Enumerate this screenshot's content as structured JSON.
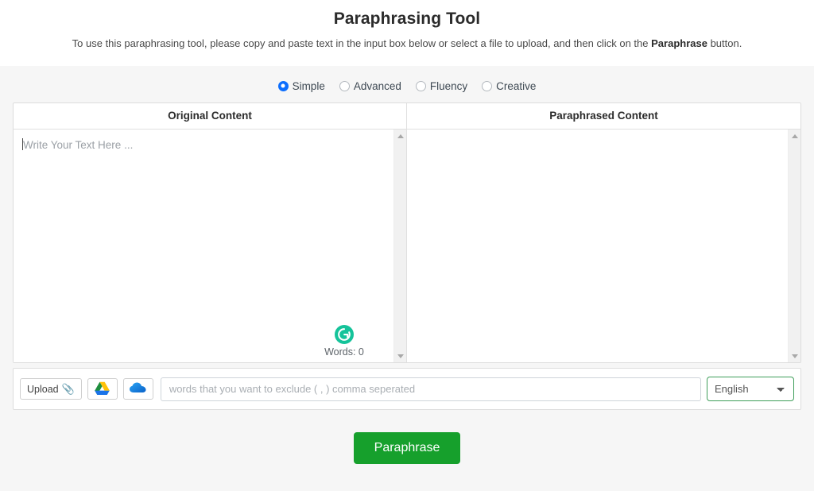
{
  "header": {
    "title": "Paraphrasing Tool",
    "subtitle_before": "To use this paraphrasing tool, please copy and paste text in the input box below or select a file to upload, and then click on the ",
    "subtitle_bold": "Paraphrase",
    "subtitle_after": " button."
  },
  "modes": {
    "options": [
      {
        "label": "Simple",
        "selected": true
      },
      {
        "label": "Advanced",
        "selected": false
      },
      {
        "label": "Fluency",
        "selected": false
      },
      {
        "label": "Creative",
        "selected": false
      }
    ]
  },
  "panels": {
    "original_header": "Original Content",
    "paraphrased_header": "Paraphrased Content",
    "input_placeholder": "Write Your Text Here ...",
    "word_count": "Words: 0",
    "grammarly_icon": "grammarly-icon",
    "scroll_up_icon": "scroll-up-arrow-icon",
    "scroll_down_icon": "scroll-down-arrow-icon"
  },
  "toolbar": {
    "upload_label": "Upload",
    "upload_icon": "paperclip-icon",
    "google_drive_icon": "google-drive-icon",
    "onedrive_icon": "onedrive-cloud-icon",
    "exclude_placeholder": "words that you want to exclude ( , ) comma seperated",
    "exclude_value": "",
    "language_selected": "English",
    "language_options": [
      "English"
    ]
  },
  "submit": {
    "label": "Paraphrase"
  },
  "colors": {
    "accent_green": "#16a02c",
    "select_border_green": "#3f9e5a",
    "radio_blue": "#0d6efd",
    "grammarly_green": "#15c39a",
    "page_background": "#f6f6f6",
    "panel_background": "#ffffff"
  }
}
